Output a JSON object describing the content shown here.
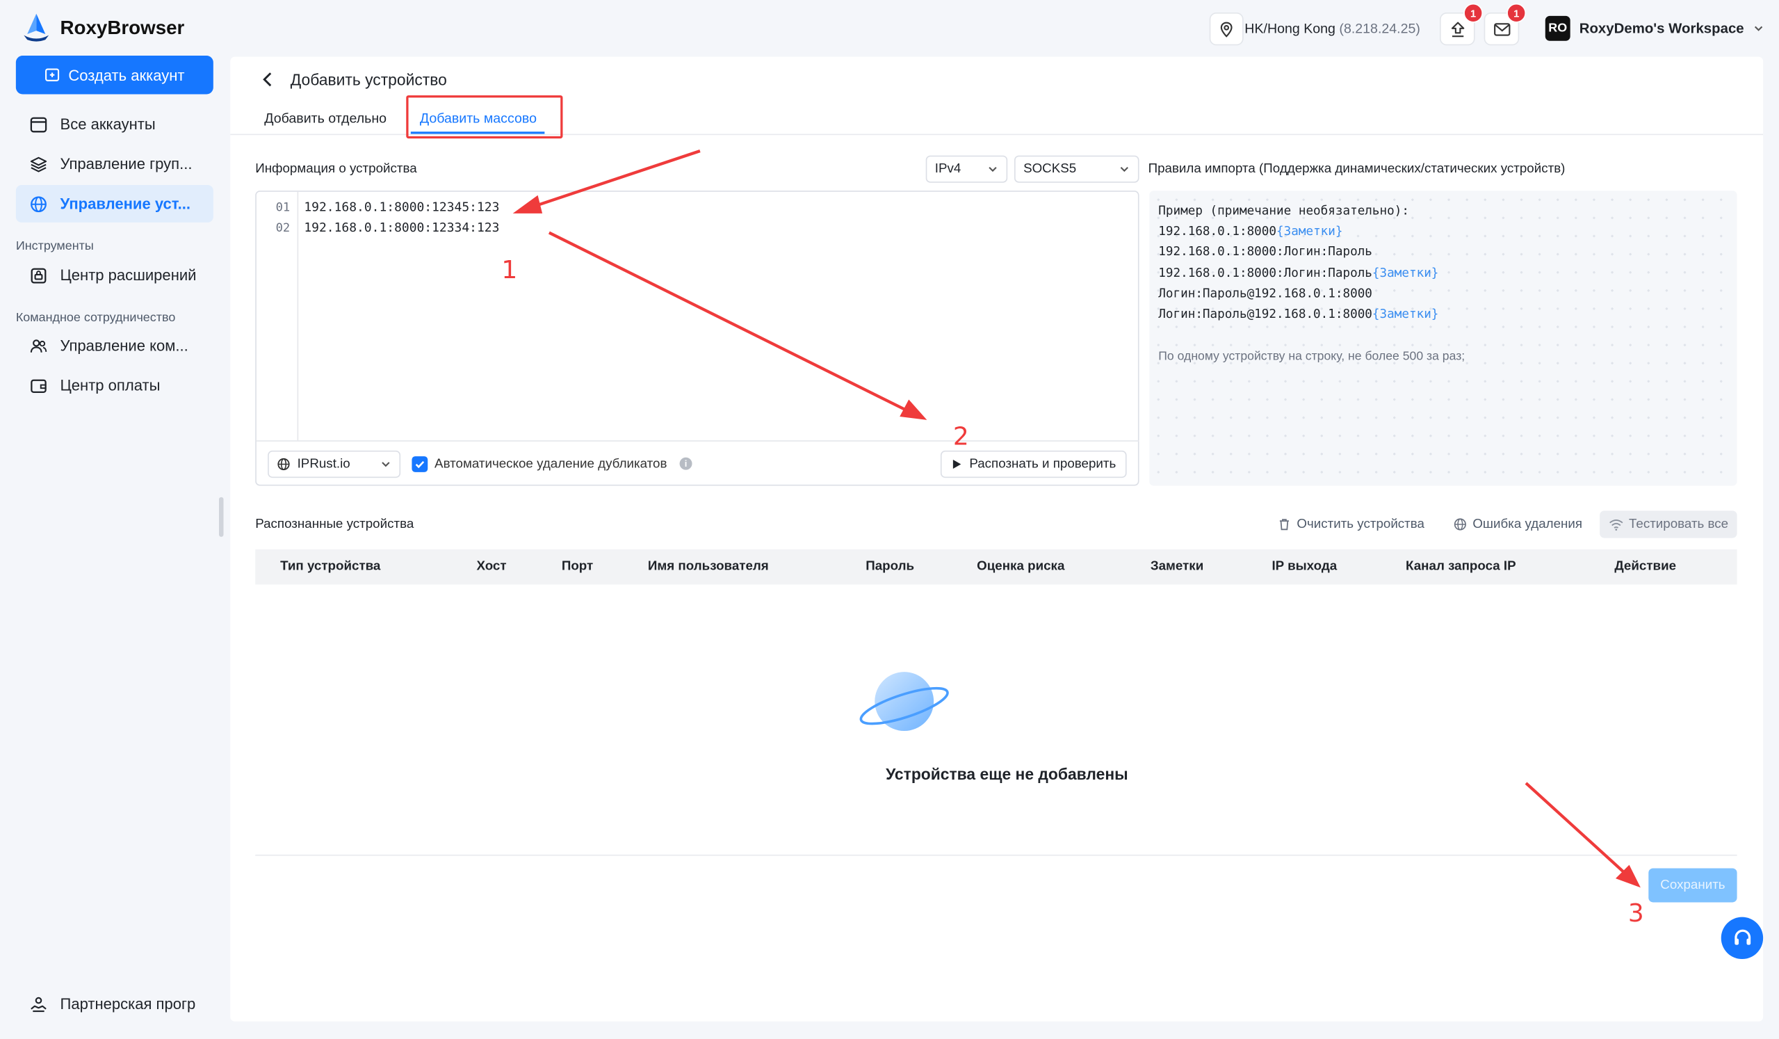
{
  "header": {
    "brand": "RoxyBrowser",
    "location": "HK/Hong Kong",
    "ip": "(8.218.24.25)",
    "upload_badge": "1",
    "mail_badge": "1",
    "avatar_initials": "RO",
    "workspace": "RoxyDemo's Workspace"
  },
  "sidebar": {
    "create_button": "Создать аккаунт",
    "items": [
      {
        "label": "Все аккаунты"
      },
      {
        "label": "Управление груп..."
      },
      {
        "label": "Управление уст..."
      }
    ],
    "section_tools": "Инструменты",
    "tools_items": [
      {
        "label": "Центр расширений"
      }
    ],
    "section_team": "Командное сотрудничество",
    "team_items": [
      {
        "label": "Управление ком..."
      },
      {
        "label": "Центр оплаты"
      }
    ],
    "partner": "Партнерская прогр"
  },
  "page": {
    "title": "Добавить устройство",
    "tabs": [
      {
        "label": "Добавить отдельно"
      },
      {
        "label": "Добавить массово"
      }
    ],
    "device_info_label": "Информация о устройства",
    "ip_version": "IPv4",
    "protocol": "SOCKS5",
    "editor_lines": [
      {
        "num": "01",
        "text": "192.168.0.1:8000:12345:123"
      },
      {
        "num": "02",
        "text": "192.168.0.1:8000:12334:123"
      }
    ],
    "checker": "IPRust.io",
    "auto_dedupe": "Автоматическое удаление дубликатов",
    "recognize_button": "Распознать и проверить",
    "rules_title": "Правила импорта (Поддержка динамических/статических устройств)",
    "rules_example": "Пример (примечание необязательно):",
    "rules": [
      {
        "text": "192.168.0.1:8000",
        "note": "{Заметки}"
      },
      {
        "text": "192.168.0.1:8000:Логин:Пароль",
        "note": ""
      },
      {
        "text": "192.168.0.1:8000:Логин:Пароль",
        "note": "{Заметки}"
      },
      {
        "text": "Логин:Пароль@192.168.0.1:8000",
        "note": ""
      },
      {
        "text": "Логин:Пароль@192.168.0.1:8000",
        "note": "{Заметки}"
      }
    ],
    "rules_hint": "По одному устройству на строку, не более 500 за раз;",
    "recognized_label": "Распознанные устройства",
    "clear_devices": "Очистить устройства",
    "delete_error": "Ошибка удаления",
    "test_all": "Тестировать все",
    "columns": [
      "Тип устройства",
      "Хост",
      "Порт",
      "Имя пользователя",
      "Пароль",
      "Оценка риска",
      "Заметки",
      "IP выхода",
      "Канал запроса IP",
      "Действие"
    ],
    "empty_text": "Устройства еще не добавлены",
    "save_button": "Сохранить"
  },
  "annotations": {
    "step1": "1",
    "step2": "2",
    "step3": "3"
  },
  "colors": {
    "accent": "#1677ff",
    "annotation": "#ef3b3b",
    "badge": "#e5343d"
  }
}
